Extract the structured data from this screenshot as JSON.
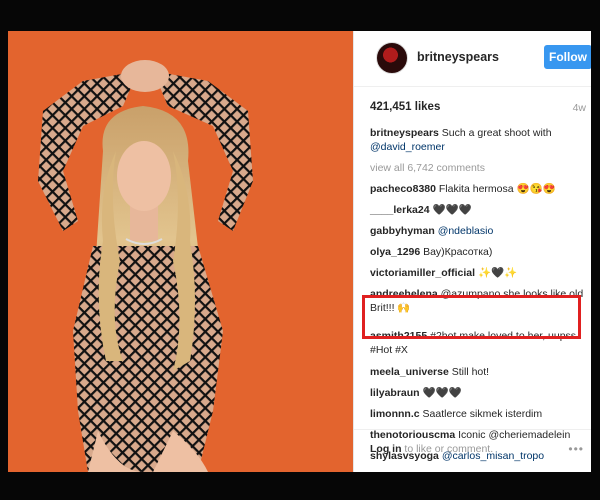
{
  "post": {
    "username": "britneyspears",
    "follow_label": "Follow",
    "likes": "421,451 likes",
    "age": "4w",
    "caption_user": "britneyspears",
    "caption_text": "Such a great shoot with",
    "caption_mention": "@david_roemer",
    "view_all": "view all 6,742 comments",
    "comments": [
      {
        "user": "pacheco8380",
        "text": "Flakita hermosa 😍😘😍"
      },
      {
        "user": "____lerka24",
        "text": "🖤🖤🖤"
      },
      {
        "user": "gabbyhyman",
        "text": "@ndeblasio"
      },
      {
        "user": "olya_1296",
        "text": "Вау)Красотка)"
      },
      {
        "user": "victoriamiller_official",
        "text": "✨🖤✨"
      },
      {
        "user": "andreehelena",
        "text": "@azumpano she looks like old Brit!!! 🙌"
      },
      {
        "user": "asmith2155",
        "text": "#2hot make loved to her, uupss #Hot #X"
      },
      {
        "user": "meela_universe",
        "text": "Still hot!"
      },
      {
        "user": "lilyabraun",
        "text": "🖤🖤🖤"
      },
      {
        "user": "limonnn.c",
        "text": "Saatlerce sikmek isterdim"
      },
      {
        "user": "thenotoriouscma",
        "text": "Iconic @cheriemadelein"
      },
      {
        "user": "shylasvsyoga",
        "text": "@carlos_misan_tropo"
      }
    ],
    "login_link": "Log in",
    "login_text": "to like or comment.",
    "more": "•••"
  },
  "colors": {
    "photo_background": "#e3642e",
    "follow_button": "#3897f0",
    "highlight_box": "#e02020"
  }
}
